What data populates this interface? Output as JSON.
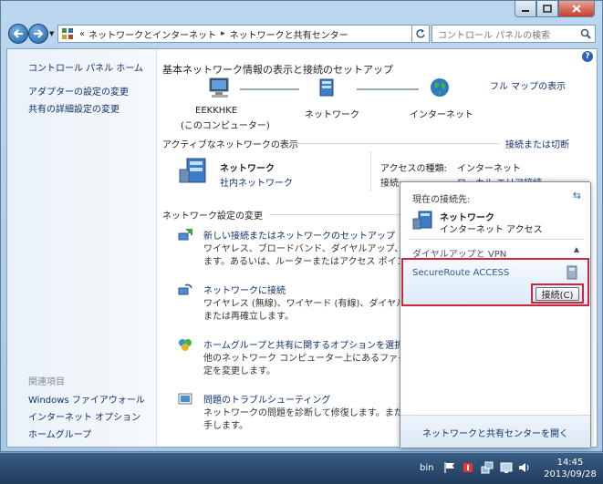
{
  "window": {
    "minimize": "0",
    "maximize": "1",
    "close": "r"
  },
  "address": {
    "prefix": "«",
    "segments": [
      "ネットワークとインターネット",
      "ネットワークと共有センター"
    ],
    "search_placeholder": "コントロール パネルの検索"
  },
  "sidebar": {
    "home": "コントロール パネル ホーム",
    "items": [
      "アダプターの設定の変更",
      "共有の詳細設定の変更"
    ],
    "related_head": "関連項目",
    "related": [
      "Windows ファイアウォール",
      "インターネット オプション",
      "ホームグループ"
    ]
  },
  "main": {
    "title": "基本ネットワーク情報の表示と接続のセットアップ",
    "full_map": "フル マップの表示",
    "nodes": {
      "computer_name": "EEKKHKE",
      "computer_sub": "(このコンピューター)",
      "network": "ネットワーク",
      "internet": "インターネット"
    },
    "active_head": "アクティブなネットワークの表示",
    "connect_or_disconnect": "接続または切断",
    "active_net_name": "ネットワーク",
    "active_net_type": "社内ネットワーク",
    "access_type_label": "アクセスの種類:",
    "access_type_value": "インターネット",
    "connection_label": "接続:",
    "connection_value": "ローカル エリア接続",
    "change_head": "ネットワーク設定の変更",
    "tasks": [
      {
        "title": "新しい接続またはネットワークのセットアップ",
        "desc1": "ワイヤレス、ブロードバンド、ダイヤルアップ、アドホ",
        "desc2": "ます。あるいは、ルーターまたはアクセス ポイントを"
      },
      {
        "title": "ネットワークに接続",
        "desc1": "ワイヤレス (無線)、ワイヤード (有線)、ダイヤルアップ",
        "desc2": "または再確立します。"
      },
      {
        "title": "ホームグループと共有に関するオプションを選択する",
        "desc1": "他のネットワーク コンピューター上にあるファイルやプ",
        "desc2": "定を変更します。"
      },
      {
        "title": "問題のトラブルシューティング",
        "desc1": "ネットワークの問題を診断して修復します。または、ト",
        "desc2": "手します。"
      }
    ]
  },
  "flyout": {
    "current_label": "現在の接続先:",
    "net_name": "ネットワーク",
    "net_sub": "インターネット アクセス",
    "vpn_head": "ダイヤルアップと VPN",
    "conn_name": "SecureRoute ACCESS",
    "connect_btn": "接続(C)",
    "open_center": "ネットワークと共有センターを開く"
  },
  "taskbar": {
    "user": "bin",
    "time": "14:45",
    "date": "2013/09/28"
  }
}
